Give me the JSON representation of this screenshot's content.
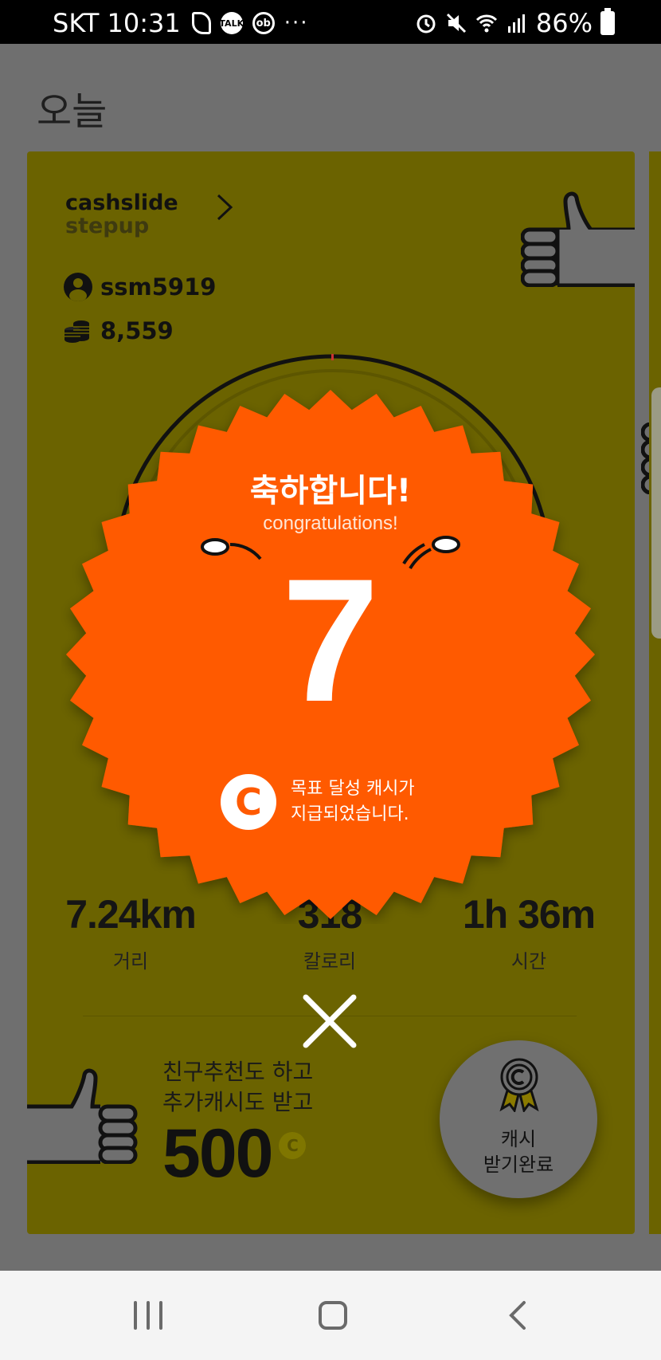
{
  "status_bar": {
    "carrier_time": "SKT 10:31",
    "talk_icon_label": "TALK",
    "dots": "···",
    "battery": "86%",
    "icons": [
      "leaf-icon",
      "talk-icon",
      "ob-icon",
      "alarm-icon",
      "mute-icon",
      "wifi-icon",
      "signal-icon",
      "battery-icon"
    ]
  },
  "page": {
    "title": "오늘"
  },
  "card": {
    "brand_line1": "cashslide",
    "brand_line2": "stepup",
    "username": "ssm5919",
    "cash_balance": "8,559",
    "stats": [
      {
        "value": "7.24km",
        "label": "거리"
      },
      {
        "value": "318",
        "label": "칼로리"
      },
      {
        "value": "1h 36m",
        "label": "시간"
      }
    ],
    "promo_line1": "친구추천도 하고",
    "promo_line2": "추가캐시도 받고",
    "promo_amount": "500",
    "promo_unit_mark": "C",
    "receive_line1": "캐시",
    "receive_line2": "받기완료"
  },
  "popup": {
    "title_ko": "축하합니다!",
    "title_en": "congratulations!",
    "number": "7",
    "logo_letter": "C",
    "message_line1": "목표 달성 캐시가",
    "message_line2": "지급되었습니다."
  },
  "colors": {
    "badge": "#ff5a00",
    "card_dim": "#6b6300",
    "overlay": "#6f6f6f"
  }
}
